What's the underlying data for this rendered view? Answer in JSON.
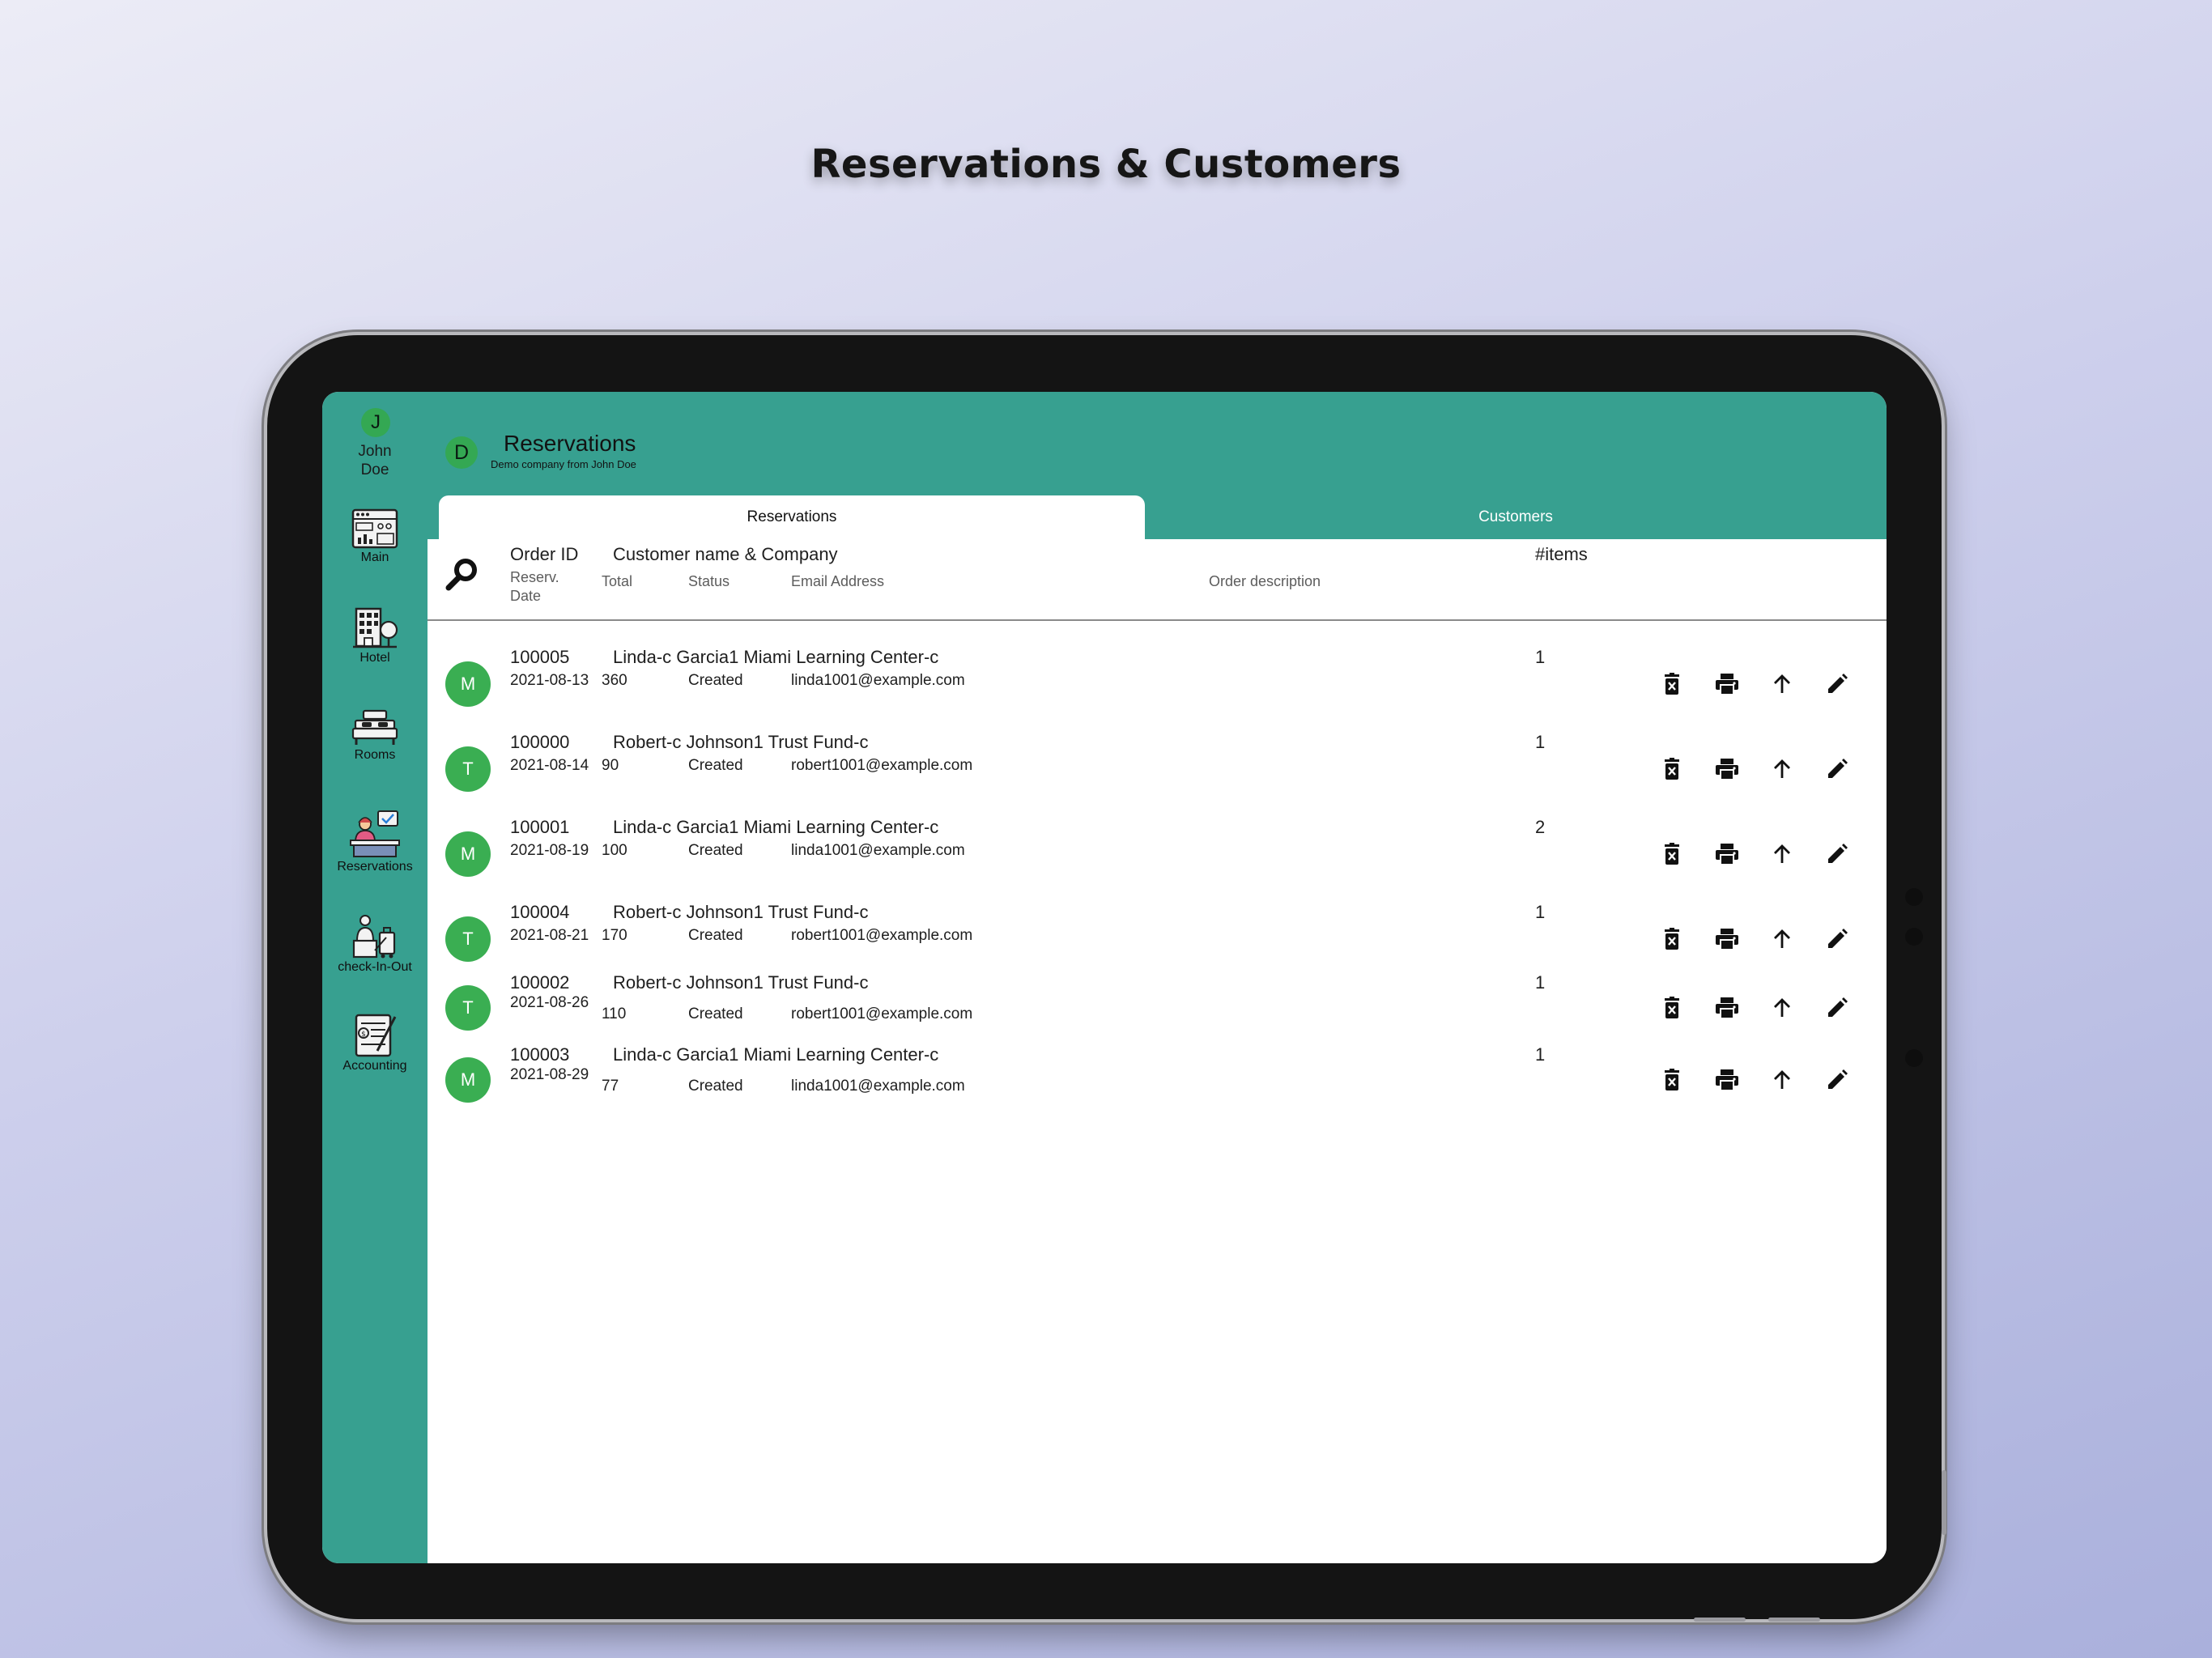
{
  "banner": {
    "title": "Reservations & Customers"
  },
  "user": {
    "initial": "J",
    "name_line1": "John",
    "name_line2": "Doe"
  },
  "nav": [
    {
      "label": "Main",
      "icon": "dashboard-icon"
    },
    {
      "label": "Hotel",
      "icon": "hotel-building-icon"
    },
    {
      "label": "Rooms",
      "icon": "bed-icon"
    },
    {
      "label": "Reservations",
      "icon": "receptionist-icon"
    },
    {
      "label": "check-In-Out",
      "icon": "luggage-icon"
    },
    {
      "label": "Accounting",
      "icon": "ledger-icon"
    }
  ],
  "header": {
    "company_initial": "D",
    "title": "Reservations",
    "subtitle": "Demo company from John Doe"
  },
  "tabs": {
    "reservations": "Reservations",
    "customers": "Customers"
  },
  "columns": {
    "order_id": "Order ID",
    "customer": "Customer name & Company",
    "items": "#items",
    "date_line1": "Reserv.",
    "date_line2": "Date",
    "total": "Total",
    "status": "Status",
    "email": "Email Address",
    "description": "Order description"
  },
  "reservations": [
    {
      "avatar": "M",
      "order_id": "100005",
      "customer": "Linda-c Garcia1 Miami Learning Center-c",
      "date": "2021-08-13",
      "total": "360",
      "status": "Created",
      "email": "linda1001@example.com",
      "items": "1"
    },
    {
      "avatar": "T",
      "order_id": "100000",
      "customer": "Robert-c Johnson1 Trust Fund-c",
      "date": "2021-08-14",
      "total": "90",
      "status": "Created",
      "email": "robert1001@example.com",
      "items": "1"
    },
    {
      "avatar": "M",
      "order_id": "100001",
      "customer": "Linda-c Garcia1 Miami Learning Center-c",
      "date": "2021-08-19",
      "total": "100",
      "status": "Created",
      "email": "linda1001@example.com",
      "items": "2"
    },
    {
      "avatar": "T",
      "order_id": "100004",
      "customer": "Robert-c Johnson1 Trust Fund-c",
      "date": "2021-08-21",
      "total": "170",
      "status": "Created",
      "email": "robert1001@example.com",
      "items": "1"
    },
    {
      "avatar": "T",
      "order_id": "100002",
      "customer": "Robert-c Johnson1 Trust Fund-c",
      "date": "2021-08-26",
      "total": "110",
      "status": "Created",
      "email": "robert1001@example.com",
      "items": "1"
    },
    {
      "avatar": "M",
      "order_id": "100003",
      "customer": "Linda-c Garcia1 Miami Learning Center-c",
      "date": "2021-08-29",
      "total": "77",
      "status": "Created",
      "email": "linda1001@example.com",
      "items": "1"
    }
  ],
  "row_actions": [
    "delete-icon",
    "print-icon",
    "arrow-up-icon",
    "edit-icon"
  ],
  "fab": {
    "label": "+"
  },
  "colors": {
    "brand": "#37a090",
    "avatar": "#3aae52",
    "fab": "#1a7fdb"
  }
}
